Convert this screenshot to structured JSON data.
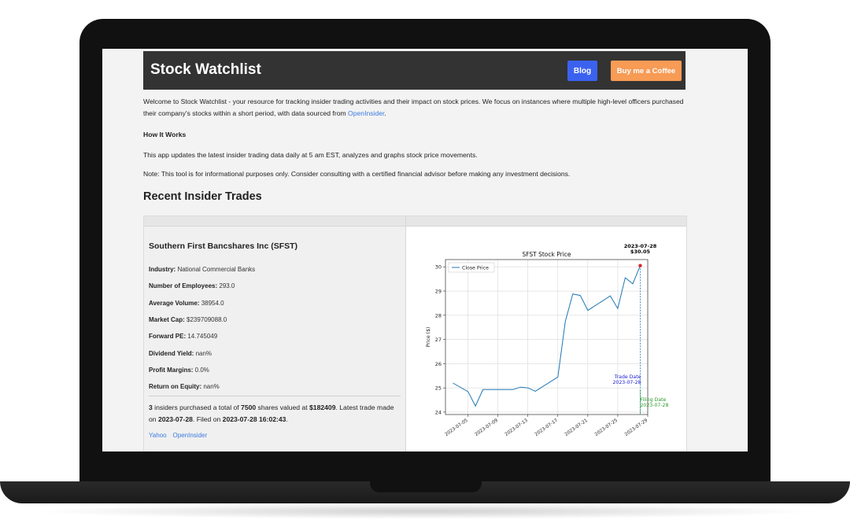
{
  "nav": {
    "brand": "Stock Watchlist",
    "blog_label": "Blog",
    "coffee_label": "Buy me a Coffee"
  },
  "intro": {
    "text": "Welcome to Stock Watchlist - your resource for tracking insider trading activities and their impact on stock prices. We focus on instances where multiple high-level officers purchased their company's stocks within a short period, with data sourced from ",
    "link": "OpenInsider",
    "end": "."
  },
  "how": {
    "heading": "How It Works",
    "p1": "This app updates the latest insider trading data daily at 5 am EST, analyzes and graphs stock price movements.",
    "p2": "Note: This tool is for informational purposes only. Consider consulting with a certified financial advisor before making any investment decisions."
  },
  "recent_heading": "Recent Insider Trades",
  "trade": {
    "company": "Southern First Bancshares Inc (SFST)",
    "stats": [
      {
        "label": "Industry:",
        "value": "National Commercial Banks"
      },
      {
        "label": "Number of Employees:",
        "value": "293.0"
      },
      {
        "label": "Average Volume:",
        "value": "38954.0"
      },
      {
        "label": "Market Cap:",
        "value": "$239709088.0"
      },
      {
        "label": "Forward PE:",
        "value": "14.745049"
      },
      {
        "label": "Dividend Yield:",
        "value": "nan%"
      },
      {
        "label": "Profit Margins:",
        "value": "0.0%"
      },
      {
        "label": "Return on Equity:",
        "value": "nan%"
      }
    ],
    "summary": {
      "insiders": "3",
      "t1": " insiders purchased a total of ",
      "shares": "7500",
      "t2": " shares valued at ",
      "value": "$182409",
      "t3": ". Latest trade made on ",
      "trade_date": "2023-07-28",
      "t4": ". Filed on ",
      "filed": "2023-07-28 16:02:43",
      "t5": "."
    },
    "links": {
      "yahoo": "Yahoo",
      "openinsider": "OpenInsider"
    }
  },
  "chart_data": {
    "type": "line",
    "title": "SFST Stock Price",
    "xlabel": "",
    "ylabel": "Price ($)",
    "legend": "top-left",
    "grid": true,
    "series": [
      {
        "name": "Close Price",
        "color": "#1f77b4",
        "x": [
          "2023-07-03",
          "2023-07-05",
          "2023-07-06",
          "2023-07-07",
          "2023-07-10",
          "2023-07-11",
          "2023-07-12",
          "2023-07-13",
          "2023-07-14",
          "2023-07-17",
          "2023-07-18",
          "2023-07-19",
          "2023-07-20",
          "2023-07-21",
          "2023-07-24",
          "2023-07-25",
          "2023-07-26",
          "2023-07-27",
          "2023-07-28"
        ],
        "y": [
          25.2,
          24.85,
          24.25,
          24.93,
          24.93,
          24.93,
          25.03,
          25.0,
          24.86,
          25.45,
          27.75,
          28.88,
          28.82,
          28.2,
          28.8,
          28.28,
          29.55,
          29.3,
          30.05
        ]
      }
    ],
    "xlim": [
      "2023-07-02",
      "2023-07-29"
    ],
    "xticks": [
      "2023-07-05",
      "2023-07-09",
      "2023-07-13",
      "2023-07-17",
      "2023-07-21",
      "2023-07-25",
      "2023-07-29"
    ],
    "ylim": [
      23.9,
      30.3
    ],
    "yticks": [
      24,
      25,
      26,
      27,
      28,
      29,
      30
    ],
    "annotations": [
      {
        "kind": "peak",
        "text1": "2023-07-28",
        "text2": "$30.05",
        "color": "#000000"
      },
      {
        "kind": "trade",
        "text1": "Trade Date",
        "text2": "2023-07-28",
        "color": "#1a1ad6"
      },
      {
        "kind": "filing",
        "text1": "Filing Date",
        "text2": "2023-07-28",
        "color": "#2e9a2e"
      }
    ]
  }
}
